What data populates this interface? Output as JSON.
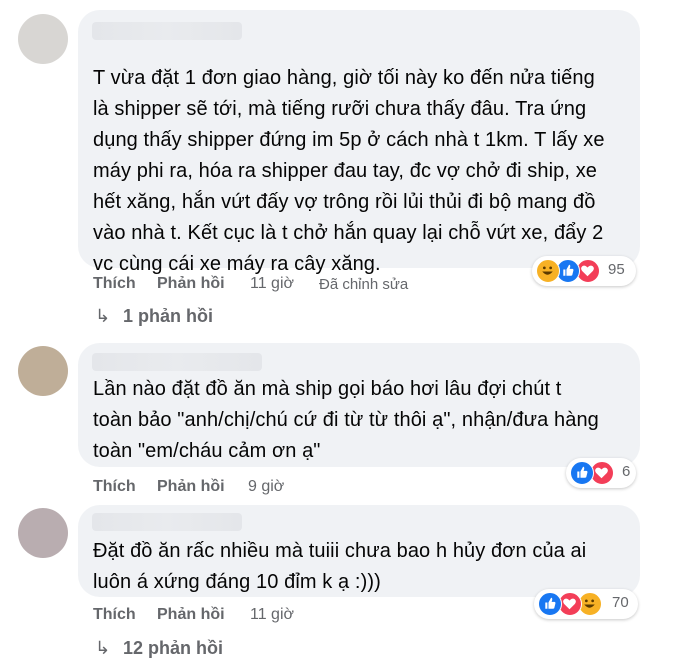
{
  "comments": [
    {
      "text": "T vừa đặt 1 đơn giao hàng, giờ tối này ko đến nửa tiếng\nlà shipper sẽ tới, mà tiếng rưỡi chưa thấy đâu. Tra ứng\ndụng thấy shipper đứng im 5p ở cách nhà t 1km. T lấy xe\nmáy phi ra, hóa ra shipper đau tay, đc vợ chở đi ship, xe\nhết xăng, hắn vứt đấy vợ trông rồi lủi thủi đi bộ mang đồ\nvào nhà t. Kết cục là t chở hắn quay lại chỗ vứt xe, đẩy 2\nvc cùng cái xe máy ra cây xăng.",
      "like_label": "Thích",
      "reply_label": "Phản hồi",
      "time": "11 giờ",
      "edited": "Đã chỉnh sửa",
      "reactions": [
        "haha",
        "like",
        "love"
      ],
      "reaction_count": "95",
      "replies_label": "1 phản hồi"
    },
    {
      "text": "Lần nào đặt đồ ăn mà ship gọi báo hơi lâu đợi chút t\ntoàn bảo \"anh/chị/chú cứ đi từ từ thôi ạ\", nhận/đưa hàng\ntoàn \"em/cháu cảm ơn ạ\"",
      "like_label": "Thích",
      "reply_label": "Phản hồi",
      "time": "9 giờ",
      "reactions": [
        "like",
        "love"
      ],
      "reaction_count": "6"
    },
    {
      "text": "Đặt đồ ăn rấc nhiều mà tuiii chưa bao h hủy đơn của ai\nluôn á xứng đáng 10 đỉm k ạ :)))",
      "like_label": "Thích",
      "reply_label": "Phản hồi",
      "time": "11 giờ",
      "reactions": [
        "like",
        "love",
        "haha"
      ],
      "reaction_count": "70",
      "replies_label": "12 phản hồi"
    }
  ],
  "icons": {
    "reply_arrow": "reply-arrow-icon",
    "like": "like-icon",
    "love": "love-icon",
    "haha": "haha-icon"
  },
  "colors": {
    "bubble": "#f0f2f5",
    "meta": "#65676b",
    "like": "#1877f2",
    "love": "#f33e58",
    "haha": "#f7b125"
  }
}
